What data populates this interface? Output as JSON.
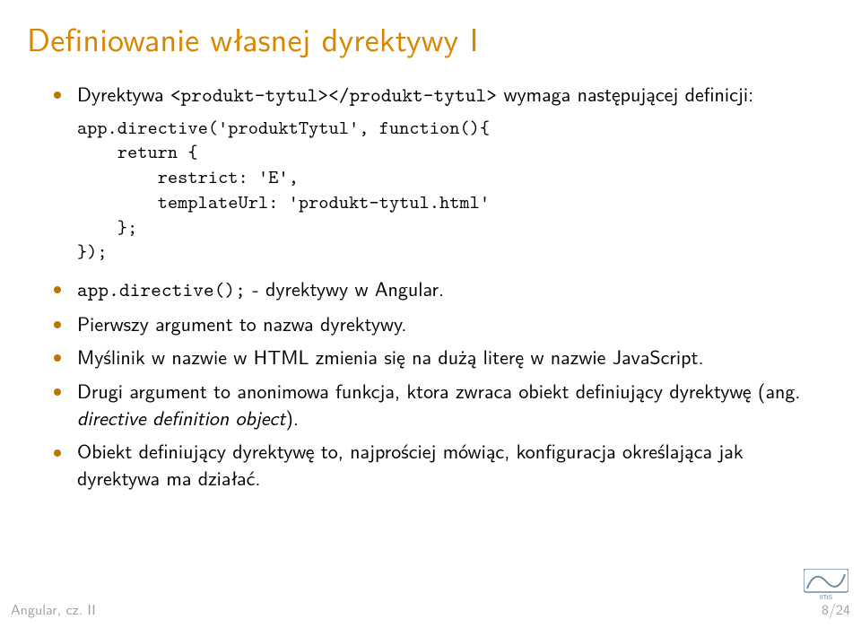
{
  "title": "Definiowanie własnej dyrektywy I",
  "items": [
    {
      "pre": "Dyrektywa ",
      "code1": "<produkt-tytul></produkt-tytul>",
      "post": " wymaga następującej definicji:"
    },
    {
      "plain_pre": "",
      "code1": "app.directive();",
      "plain_post": " - dyrektywy w Angular."
    },
    {
      "plain": "Pierwszy argument to nazwa dyrektywy."
    },
    {
      "plain": "Myślinik w nazwie w HTML zmienia się na dużą literę w nazwie JavaScript."
    },
    {
      "plain_pre": "Drugi argument to anonimowa funkcja, ktora zwraca obiekt definiujący dyrektywę (ang. ",
      "ital": "directive definition object",
      "plain_post": ")."
    },
    {
      "plain": "Obiekt definiujący dyrektywę to, najprościej mówiąc, konfiguracja określająca jak dyrektywa ma działać."
    }
  ],
  "code": "app.directive('produktTytul', function(){\n    return {\n        restrict: 'E',\n        templateUrl: 'produkt-tytul.html'\n    };\n});",
  "footer": {
    "left": "Angular, cz. II",
    "right": "8/24"
  },
  "logo_label": "IITiS"
}
